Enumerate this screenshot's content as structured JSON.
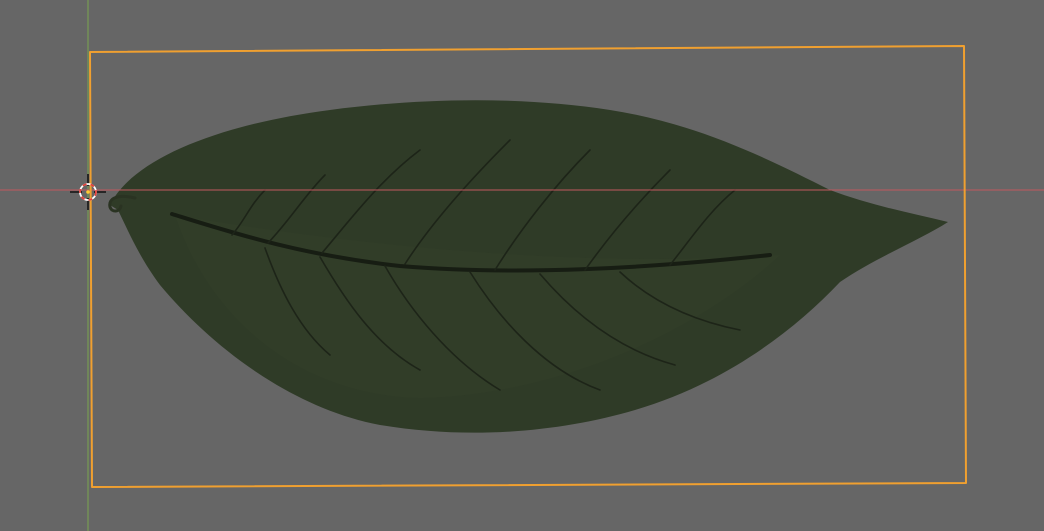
{
  "viewport": {
    "mode": "3d-viewport-top-orthographic",
    "background_color": "#666666"
  },
  "axes": {
    "x_axis_color": "#c2585f",
    "y_axis_color": "#7aa64d"
  },
  "selection": {
    "outline_color": "#f0a030",
    "selected_object": "leaf-plane"
  },
  "leaf": {
    "fill_color": "#2f3b27",
    "vein_color": "#1a2016",
    "highlight_color": "#3a4a30"
  },
  "cursor_3d": {
    "icon": "3d-cursor-icon",
    "ring_color_a": "#ffffff",
    "ring_color_b": "#e0403a"
  }
}
